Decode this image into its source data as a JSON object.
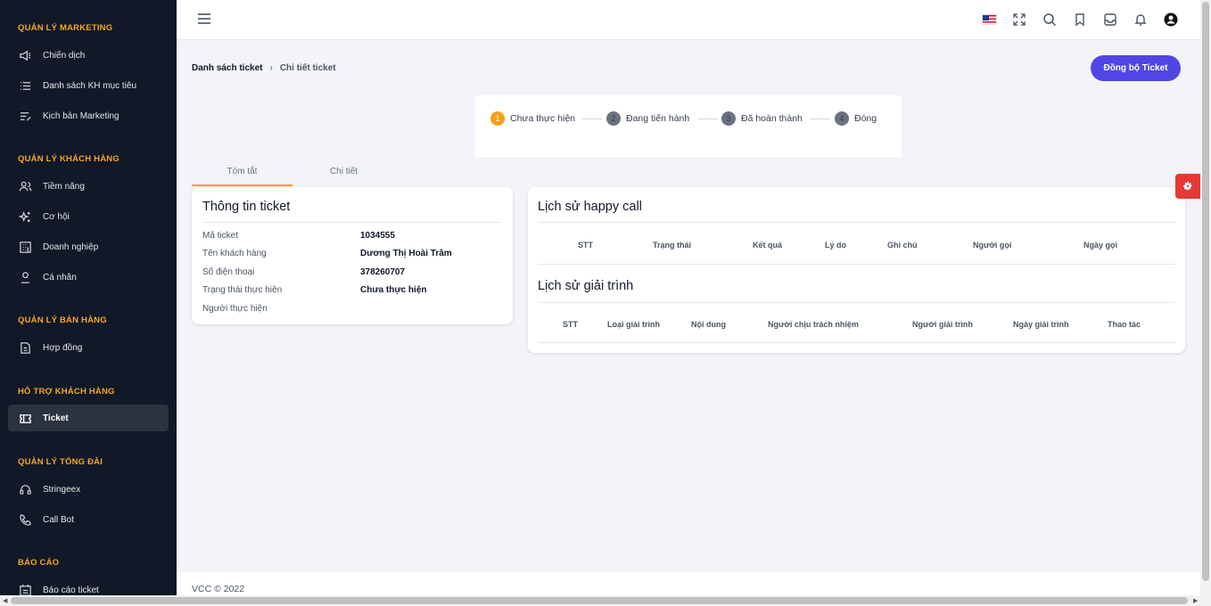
{
  "sidebar": {
    "sections": [
      {
        "title": "QUẢN LÝ MARKETING",
        "items": [
          {
            "label": "Chiến dịch",
            "icon": "megaphone-icon"
          },
          {
            "label": "Danh sách KH mục tiêu",
            "icon": "list-icon"
          },
          {
            "label": "Kịch bản Marketing",
            "icon": "script-icon"
          }
        ]
      },
      {
        "title": "QUẢN LÝ KHÁCH HÀNG",
        "items": [
          {
            "label": "Tiềm năng",
            "icon": "users-icon"
          },
          {
            "label": "Cơ hội",
            "icon": "sparkle-icon"
          },
          {
            "label": "Doanh nghiệp",
            "icon": "building-icon"
          },
          {
            "label": "Cá nhân",
            "icon": "user-icon"
          }
        ]
      },
      {
        "title": "QUẢN LÝ BÁN HÀNG",
        "items": [
          {
            "label": "Hợp đồng",
            "icon": "document-icon"
          }
        ]
      },
      {
        "title": "HỖ TRỢ KHÁCH HÀNG",
        "items": [
          {
            "label": "Ticket",
            "icon": "ticket-icon",
            "active": true
          }
        ]
      },
      {
        "title": "QUẢN LÝ TỔNG ĐÀI",
        "items": [
          {
            "label": "Stringeex",
            "icon": "headset-icon"
          },
          {
            "label": "Call Bot",
            "icon": "phone-icon"
          }
        ]
      },
      {
        "title": "BÁO CÁO",
        "items": [
          {
            "label": "Báo cáo ticket",
            "icon": "report-icon"
          }
        ]
      }
    ]
  },
  "header": {
    "icons": [
      "us-flag-icon",
      "fullscreen-icon",
      "search-icon",
      "bookmark-icon",
      "inbox-icon",
      "bell-icon",
      "account-icon"
    ]
  },
  "breadcrumb": {
    "root": "Danh sách ticket",
    "current": "Chi tiết ticket"
  },
  "sync_button": "Đồng bộ Ticket",
  "steps": [
    {
      "num": "1",
      "label": "Chưa thực hiện",
      "active": true
    },
    {
      "num": "2",
      "label": "Đang tiến hành"
    },
    {
      "num": "3",
      "label": "Đã hoàn thành"
    },
    {
      "num": "4",
      "label": "Đóng"
    }
  ],
  "tabs": [
    {
      "label": "Tóm tắt",
      "active": true
    },
    {
      "label": "Chi tiết"
    }
  ],
  "ticket_info": {
    "title": "Thông tin ticket",
    "rows": [
      {
        "label": "Mã ticket",
        "value": "1034555"
      },
      {
        "label": "Tên khách hàng",
        "value": "Dương Thị Hoài Trâm"
      },
      {
        "label": "Số điện thoại",
        "value": "378260707"
      },
      {
        "label": "Trạng thái thực hiện",
        "value": "Chưa thực hiện"
      },
      {
        "label": "Người thực hiện",
        "value": ""
      }
    ]
  },
  "happy_call": {
    "title": "Lịch sử happy call",
    "columns": [
      "STT",
      "Trạng thái",
      "Kết quả",
      "Lý do",
      "Ghi chú",
      "Người gọi",
      "Ngày gọi"
    ]
  },
  "explanation": {
    "title": "Lịch sử giải trình",
    "columns": [
      "STT",
      "Loại giải trình",
      "Nội dung",
      "Người chịu trách nhiệm",
      "Người giải trình",
      "Ngày giải trình",
      "Thao tác"
    ]
  },
  "footer": "VCC © 2022",
  "colors": {
    "sidebar_bg": "#111827",
    "section_title": "#f5a623",
    "primary": "#4f46e5",
    "step_active": "#f5a01a",
    "settings": "#e53935"
  }
}
